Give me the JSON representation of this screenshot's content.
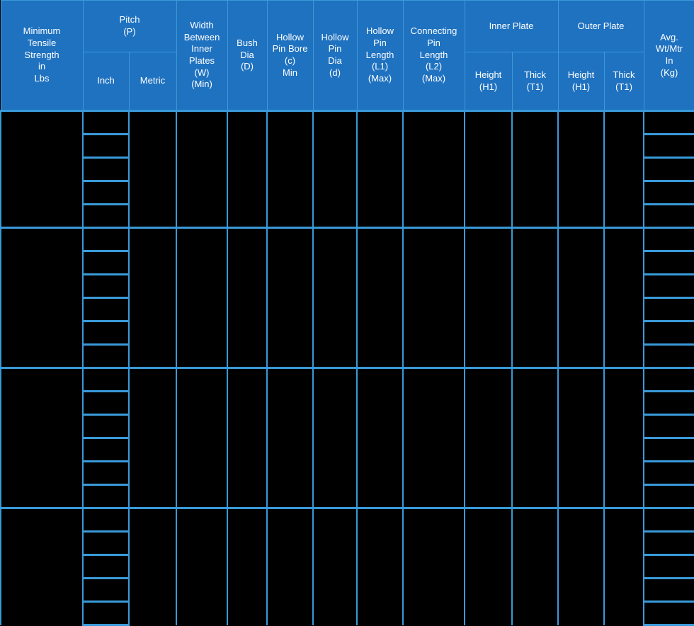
{
  "table": {
    "grid_color": "#3a9ad9",
    "header_bg": "#1f72c0",
    "header_text_color": "#ffffff",
    "body_bg": "#000000",
    "columns": [
      {
        "id": "min_tensile_strength",
        "label": "Minimum\nTensile\nStrength\nin\nLbs",
        "span": 1,
        "subcolumns": []
      },
      {
        "id": "pitch",
        "label": "Pitch\n(P)",
        "span": 2,
        "subcolumns": [
          {
            "id": "pitch_inch",
            "label": "Inch"
          },
          {
            "id": "pitch_metric",
            "label": "Metric"
          }
        ]
      },
      {
        "id": "width_between_inner_plates",
        "label": "Width\nBetween\nInner\nPlates\n(W)\n(Min)",
        "span": 1,
        "subcolumns": []
      },
      {
        "id": "bush_dia",
        "label": "Bush\nDia\n(D)",
        "span": 1,
        "subcolumns": []
      },
      {
        "id": "hollow_pin_bore",
        "label": "Hollow\nPin Bore\n(c)\nMin",
        "span": 1,
        "subcolumns": []
      },
      {
        "id": "hollow_pin_dia",
        "label": "Hollow\nPin\nDia\n(d)",
        "span": 1,
        "subcolumns": []
      },
      {
        "id": "hollow_pin_length",
        "label": "Hollow\nPin\nLength\n(L1)\n(Max)",
        "span": 1,
        "subcolumns": []
      },
      {
        "id": "connecting_pin_length",
        "label": "Connecting\nPin\nLength\n(L2)\n(Max)",
        "span": 1,
        "subcolumns": []
      },
      {
        "id": "inner_plate",
        "label": "Inner Plate",
        "span": 2,
        "subcolumns": [
          {
            "id": "inner_plate_height",
            "label": "Height\n(H1)"
          },
          {
            "id": "inner_plate_thick",
            "label": "Thick\n(T1)"
          }
        ]
      },
      {
        "id": "outer_plate",
        "label": "Outer Plate",
        "span": 2,
        "subcolumns": [
          {
            "id": "outer_plate_height",
            "label": "Height\n(H1)"
          },
          {
            "id": "outer_plate_thick",
            "label": "Thick\n(T1)"
          }
        ]
      },
      {
        "id": "avg_wt_per_mtr",
        "label": "Avg.\nWt/Mtr\nIn\n(Kg)",
        "span": 1,
        "subcolumns": []
      }
    ],
    "row_groups": [
      {
        "id": "group-1",
        "sub_rows": 5,
        "cells": {
          "min_tensile_strength": "",
          "pitch_inch": [
            "",
            "",
            "",
            "",
            ""
          ],
          "pitch_metric": "",
          "width_between_inner_plates": "",
          "bush_dia": "",
          "hollow_pin_bore": "",
          "hollow_pin_dia": "",
          "hollow_pin_length": "",
          "connecting_pin_length": "",
          "inner_plate_height": "",
          "inner_plate_thick": "",
          "outer_plate_height": "",
          "outer_plate_thick": "",
          "avg_wt_per_mtr": [
            "",
            "",
            "",
            "",
            ""
          ]
        }
      },
      {
        "id": "group-2",
        "sub_rows": 6,
        "cells": {
          "min_tensile_strength": "",
          "pitch_inch": [
            "",
            "",
            "",
            "",
            "",
            ""
          ],
          "pitch_metric": "",
          "width_between_inner_plates": "",
          "bush_dia": "",
          "hollow_pin_bore": "",
          "hollow_pin_dia": "",
          "hollow_pin_length": "",
          "connecting_pin_length": "",
          "inner_plate_height": "",
          "inner_plate_thick": "",
          "outer_plate_height": "",
          "outer_plate_thick": "",
          "avg_wt_per_mtr": [
            "",
            "",
            "",
            "",
            "",
            ""
          ]
        }
      },
      {
        "id": "group-3",
        "sub_rows": 6,
        "cells": {
          "min_tensile_strength": "",
          "pitch_inch": [
            "",
            "",
            "",
            "",
            "",
            ""
          ],
          "pitch_metric": "",
          "width_between_inner_plates": "",
          "bush_dia": "",
          "hollow_pin_bore": "",
          "hollow_pin_dia": "",
          "hollow_pin_length": "",
          "connecting_pin_length": "",
          "inner_plate_height": "",
          "inner_plate_thick": "",
          "outer_plate_height": "",
          "outer_plate_thick": "",
          "avg_wt_per_mtr": [
            "",
            "",
            "",
            "",
            "",
            ""
          ]
        }
      },
      {
        "id": "group-4",
        "sub_rows": 5,
        "cells": {
          "min_tensile_strength": "",
          "pitch_inch": [
            "",
            "",
            "",
            "",
            ""
          ],
          "pitch_metric": "",
          "width_between_inner_plates": "",
          "bush_dia": "",
          "hollow_pin_bore": "",
          "hollow_pin_dia": "",
          "hollow_pin_length": "",
          "connecting_pin_length": "",
          "inner_plate_height": "",
          "inner_plate_thick": "",
          "outer_plate_height": "",
          "outer_plate_thick": "",
          "avg_wt_per_mtr": [
            "",
            "",
            "",
            "",
            ""
          ]
        }
      }
    ]
  }
}
